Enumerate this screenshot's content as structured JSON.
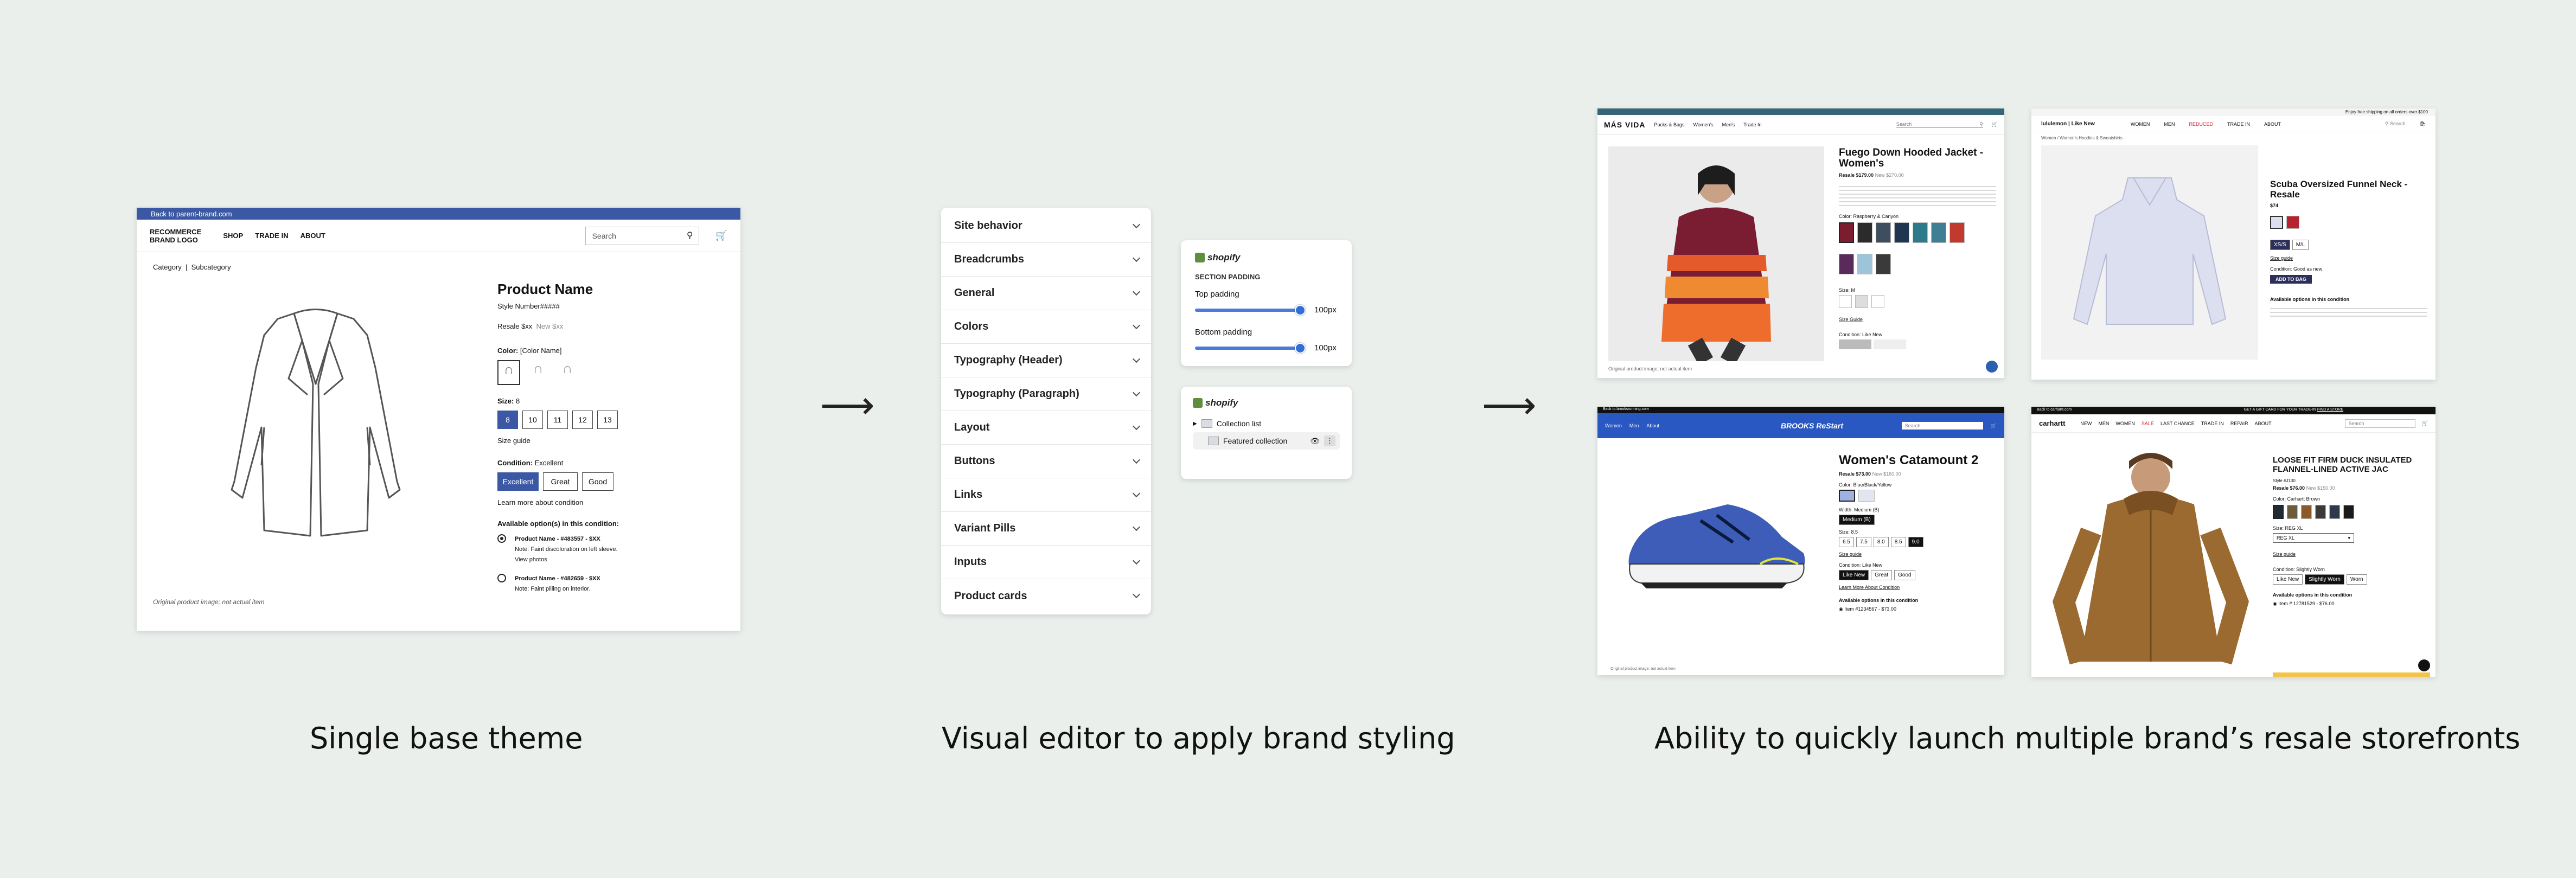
{
  "captions": {
    "left": "Single base theme",
    "middle": "Visual editor to apply brand styling",
    "right": "Ability to quickly launch multiple brand’s resale storefronts"
  },
  "arrows": {
    "a": "⟶",
    "b": "⟶"
  },
  "base_theme": {
    "top_link": "Back to parent-brand.com",
    "logo_line1": "RECOMMERCE",
    "logo_line2": "BRAND LOGO",
    "nav": [
      "SHOP",
      "TRADE IN",
      "ABOUT"
    ],
    "search_placeholder": "Search",
    "breadcrumb": "Category  |  Subcategory",
    "image_note": "Original product image; not actual item",
    "product_name": "Product Name",
    "style_number": "Style Number#####",
    "resale_label": "Resale $xx",
    "new_price": "New $xx",
    "color_label": "Color:",
    "color_value": "[Color Name]",
    "size_label": "Size:",
    "size_value": "8",
    "sizes": [
      "8",
      "10",
      "11",
      "12",
      "13"
    ],
    "size_guide": "Size guide",
    "condition_label": "Condition:",
    "condition_value": "Excellent",
    "conditions": [
      "Excellent",
      "Great",
      "Good"
    ],
    "learn_more": "Learn more about condition",
    "options_heading": "Available option(s) in this condition:",
    "option1_name": "Product Name - #483557 - $XX",
    "option1_note": "Note: Faint discoloration on left sleeve.",
    "option1_link": "View photos",
    "option2_name": "Product Name - #482659 - $XX",
    "option2_note": "Note: Faint pilling on interior."
  },
  "editor": {
    "sections": [
      "Site behavior",
      "Breadcrumbs",
      "General",
      "Colors",
      "Typography (Header)",
      "Typography (Paragraph)",
      "Layout",
      "Buttons",
      "Links",
      "Variant Pills",
      "Inputs",
      "Product cards"
    ],
    "shopify_label": "shopify",
    "padding_heading": "SECTION PADDING",
    "top_padding_label": "Top padding",
    "top_padding_value": "100px",
    "top_padding_level": 1.0,
    "bottom_padding_label": "Bottom padding",
    "bottom_padding_value": "100px",
    "bottom_padding_level": 1.0,
    "layer_items": [
      "Collection list",
      "Featured collection"
    ]
  },
  "storefronts": {
    "cotopaxi": {
      "brand": "MÁS VIDA",
      "nav": [
        "Packs & Bags",
        "Women's",
        "Men's",
        "Trade In"
      ],
      "search": "Search",
      "title": "Fuego Down Hooded Jacket - Women's",
      "price": "Resale $179.00",
      "new_price": "New $270.00",
      "color": "Color: Raspberry & Canyon",
      "size": "Size: M",
      "size_guide": "Size Guide",
      "condition": "Condition: Like New",
      "note": "Original product image; not actual item",
      "colors": [
        "#7b1d2f",
        "#2b2b2b",
        "#3e4e5e",
        "#1f3550",
        "#2d7b8a",
        "#3f7f94",
        "#c23a2e",
        "#5a2a5a",
        "#9dc4d8",
        "#3a3a3a"
      ]
    },
    "lululemon": {
      "brand": "lululemon | Like New",
      "promo": "Enjoy free shipping on all orders over $100",
      "nav": [
        "WOMEN",
        "MEN",
        "REDUCED",
        "TRADE IN",
        "ABOUT"
      ],
      "search": "Search",
      "breadcrumb": "Women / Women's Hoodies & Sweatshirts",
      "title": "Scuba Oversized Funnel Neck - Resale",
      "price": "$74",
      "size_guide": "Size guide",
      "condition": "Condition: Good as new",
      "button": "ADD TO BAG",
      "options": "Available options in this condition"
    },
    "brooks": {
      "brand": "BROOKS ReStart",
      "top": "Back to brooksrunning.com",
      "nav": [
        "Women",
        "Men",
        "About"
      ],
      "search": "Search",
      "title": "Women's Catamount 2",
      "price": "Resale $73.00",
      "new_price": "New $160.00",
      "color": "Color: Blue/Black/Yellow",
      "width": "Width: Medium (B)",
      "width_value": "Medium (B)",
      "size": "Size: 8.5",
      "sizes": [
        "6.5",
        "7.5",
        "8.0",
        "8.5",
        "9.0"
      ],
      "size_guide": "Size guide",
      "condition": "Condition: Like New",
      "conditions": [
        "Like New",
        "Great",
        "Good"
      ],
      "learn_more": "Learn More About Condition",
      "options": "Available options in this condition",
      "option": "Item #1234567 - $73.00",
      "note": "Original product image; not actual item"
    },
    "carhartt": {
      "brand": "carhartt",
      "top": "Back to carhartt.com",
      "promo": "GET A GIFT CARD FOR YOUR TRADE-IN",
      "promo_link": "FIND A STORE",
      "nav": [
        "NEW",
        "MEN",
        "WOMEN",
        "SALE",
        "LAST CHANCE",
        "TRADE IN",
        "REPAIR",
        "ABOUT"
      ],
      "search": "Search",
      "title": "LOOSE FIT FIRM DUCK INSULATED FLANNEL-LINED ACTIVE JAC",
      "style": "Style #J130",
      "price": "Resale $76.00",
      "new_price": "New $150.00",
      "color": "Color: Carhartt Brown",
      "size": "Size: REG XL",
      "size_select": "REG XL",
      "size_guide": "Size guide",
      "condition": "Condition: Slightly Worn",
      "conditions": [
        "Like New",
        "Slightly Worn",
        "Worn"
      ],
      "options": "Available options in this condition",
      "option": "Item # 12781529 - $76.00",
      "colors": [
        "#1f2a33",
        "#6c5b3c",
        "#8a5a2b",
        "#3a3a3a",
        "#2e3a4a",
        "#1a1a1a"
      ]
    }
  }
}
